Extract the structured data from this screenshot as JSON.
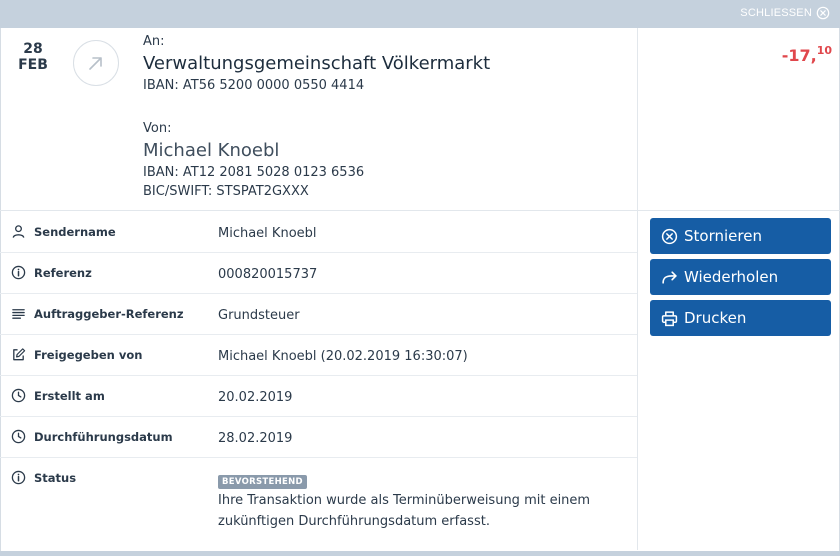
{
  "header": {
    "close_label": "SCHLIESSEN",
    "close_icon": "close-circle-icon"
  },
  "transaction": {
    "date_day": "28",
    "date_month": "FEB",
    "direction_icon": "arrow-up-right-icon",
    "recipient": {
      "label": "An:",
      "name": "Verwaltungsgemeinschaft Völkermarkt",
      "iban": "IBAN: AT56 5200 0000 0550 4414"
    },
    "sender": {
      "label": "Von:",
      "name": "Michael Knoebl",
      "iban": "IBAN: AT12 2081 5028 0123 6536",
      "bic": "BIC/SWIFT: STSPAT2GXXX"
    },
    "amount_main": "-17,",
    "amount_cents": "10",
    "amount_color": "#e0474c"
  },
  "details": [
    {
      "label": "Sendername",
      "value": "Michael Knoebl",
      "icon": "user-icon"
    },
    {
      "label": "Referenz",
      "value": "000820015737",
      "icon": "info-icon"
    },
    {
      "label": "Auftraggeber-Referenz",
      "value": "Grundsteuer",
      "icon": "lines-icon"
    },
    {
      "label": "Freigegeben von",
      "value": "Michael Knoebl (20.02.2019 16:30:07)",
      "icon": "edit-icon"
    },
    {
      "label": "Erstellt am",
      "value": "20.02.2019",
      "icon": "clock-icon"
    },
    {
      "label": "Durchführungsdatum",
      "value": "28.02.2019",
      "icon": "clock-icon"
    }
  ],
  "status": {
    "label": "Status",
    "icon": "info-icon",
    "badge": "BEVORSTEHEND",
    "text": "Ihre Transaktion wurde als Terminüberweisung mit einem zukünftigen Durchführungsdatum erfasst."
  },
  "actions": [
    {
      "label": "Stornieren",
      "icon": "cancel-circle-icon"
    },
    {
      "label": "Wiederholen",
      "icon": "redo-arrow-icon"
    },
    {
      "label": "Drucken",
      "icon": "printer-icon"
    }
  ],
  "colors": {
    "primary_button": "#165da5",
    "top_bar": "#c5d1dd",
    "status_badge": "#8a9aab"
  }
}
